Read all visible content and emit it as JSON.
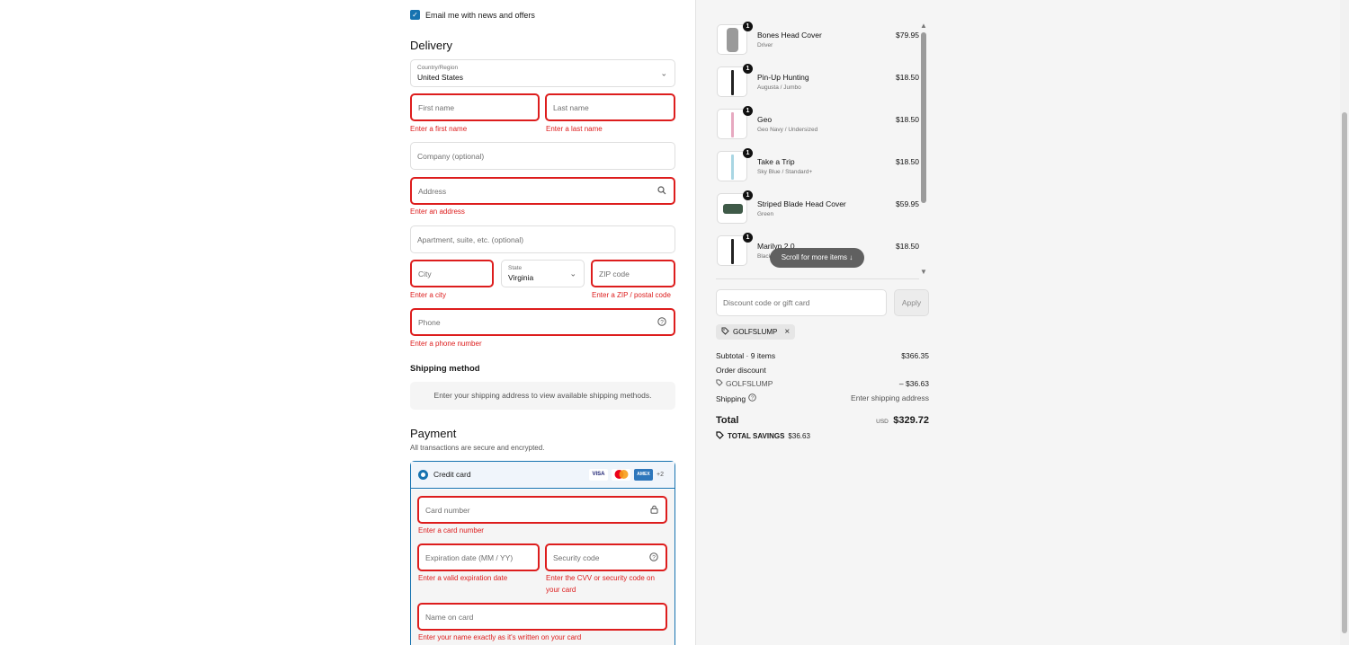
{
  "marketing": {
    "checkbox_label": "Email me with news and offers",
    "checked": true
  },
  "delivery": {
    "heading": "Delivery",
    "country": {
      "label": "Country/Region",
      "value": "United States"
    },
    "first_name": {
      "placeholder": "First name",
      "error": "Enter a first name"
    },
    "last_name": {
      "placeholder": "Last name",
      "error": "Enter a last name"
    },
    "company": {
      "placeholder": "Company (optional)"
    },
    "address": {
      "placeholder": "Address",
      "error": "Enter an address"
    },
    "apartment": {
      "placeholder": "Apartment, suite, etc. (optional)"
    },
    "city": {
      "placeholder": "City",
      "error": "Enter a city"
    },
    "state": {
      "label": "State",
      "value": "Virginia"
    },
    "zip": {
      "placeholder": "ZIP code",
      "error": "Enter a ZIP / postal code"
    },
    "phone": {
      "placeholder": "Phone",
      "error": "Enter a phone number"
    }
  },
  "shipping": {
    "heading": "Shipping method",
    "message": "Enter your shipping address to view available shipping methods."
  },
  "payment": {
    "heading": "Payment",
    "subtext": "All transactions are secure and encrypted.",
    "method_label": "Credit card",
    "card_brands": [
      "VISA",
      "MC",
      "AMEX"
    ],
    "more_brands": "+2",
    "card_number": {
      "placeholder": "Card number",
      "error": "Enter a card number"
    },
    "expiration": {
      "placeholder": "Expiration date (MM / YY)",
      "error": "Enter a valid expiration date"
    },
    "security": {
      "placeholder": "Security code",
      "error_line1": "Enter the CVV or security code on",
      "error_line2": "your card"
    },
    "name_on_card": {
      "placeholder": "Name on card",
      "error": "Enter your name exactly as it's written on your card"
    }
  },
  "cart": {
    "items": [
      {
        "name": "Bones Head Cover",
        "variant": "Driver",
        "price": "$79.95",
        "qty": "1",
        "thumb_color": "#9a9a9a"
      },
      {
        "name": "Pin-Up Hunting",
        "variant": "Augusta / Jumbo",
        "price": "$18.50",
        "qty": "1",
        "thumb_color": "#222222"
      },
      {
        "name": "Geo",
        "variant": "Geo Navy / Undersized",
        "price": "$18.50",
        "qty": "1",
        "thumb_color": "#e7a9c0"
      },
      {
        "name": "Take a Trip",
        "variant": "Sky Blue / Standard+",
        "price": "$18.50",
        "qty": "1",
        "thumb_color": "#a9d6e3"
      },
      {
        "name": "Striped Blade Head Cover",
        "variant": "Green",
        "price": "$59.95",
        "qty": "1",
        "thumb_color": "#3f5a48"
      },
      {
        "name": "Marilyn 2.0",
        "variant": "Black",
        "price": "$18.50",
        "qty": "1",
        "thumb_color": "#222222"
      }
    ],
    "scroll_hint": "Scroll for more items",
    "discount_placeholder": "Discount code or gift card",
    "apply_label": "Apply",
    "applied_code": "GOLFSLUMP",
    "subtotal_label": "Subtotal · 9 items",
    "subtotal_value": "$366.35",
    "order_discount_label": "Order discount",
    "discount_code": "GOLFSLUMP",
    "discount_value": "– $36.63",
    "shipping_label": "Shipping",
    "shipping_value": "Enter shipping address",
    "total_label": "Total",
    "currency": "USD",
    "total_value": "$329.72",
    "savings_label": "TOTAL SAVINGS",
    "savings_value": "$36.63"
  }
}
